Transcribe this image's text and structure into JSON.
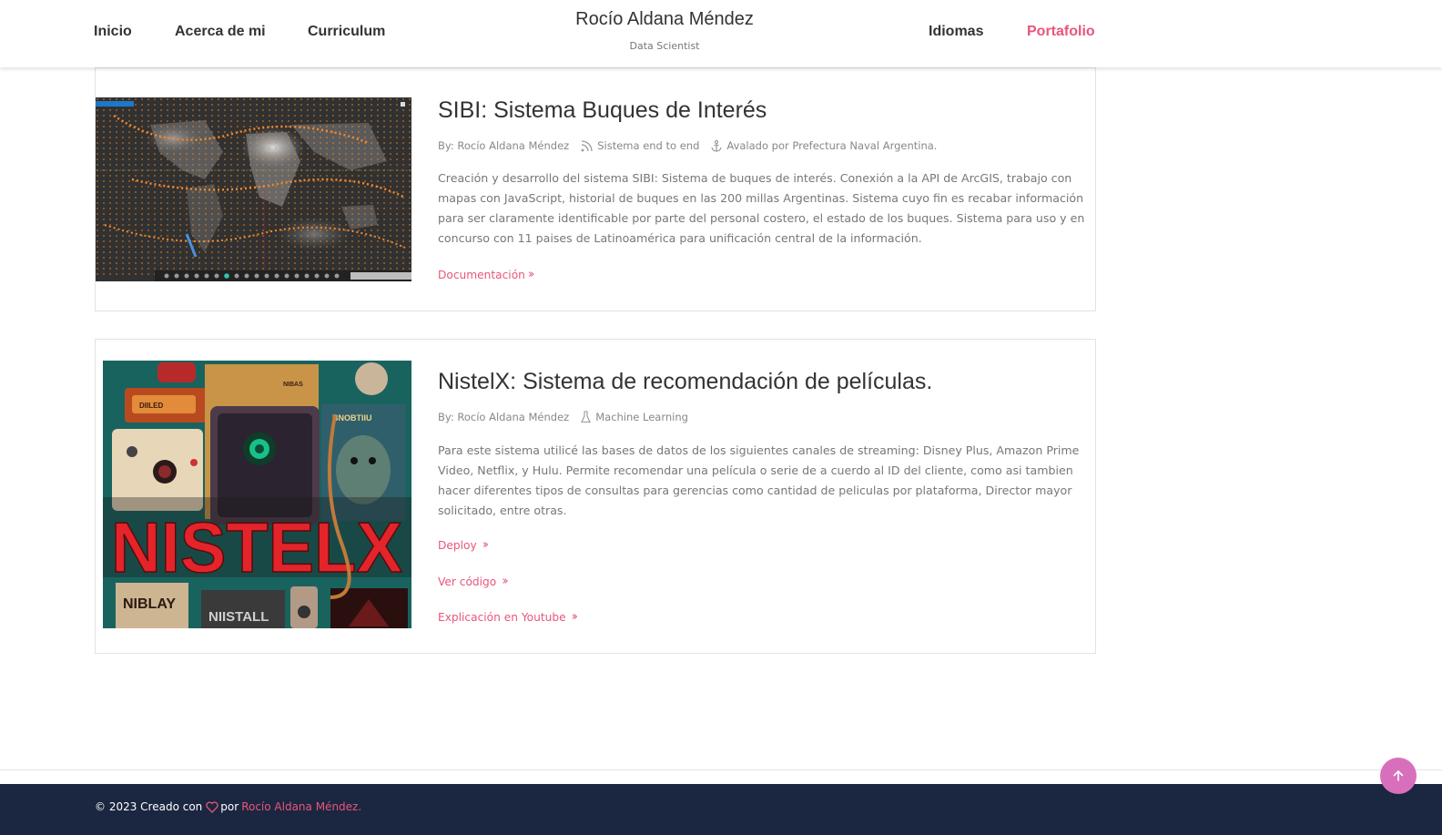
{
  "nav": {
    "left": [
      "Inicio",
      "Acerca de mi",
      "Curriculum"
    ],
    "right": [
      "Idiomas",
      "Portafolio"
    ]
  },
  "brand": {
    "name": "Rocío Aldana Méndez",
    "subtitle": "Data Scientist"
  },
  "projects": [
    {
      "title": "SIBI: Sistema Buques de Interés",
      "meta": [
        {
          "icon": "user",
          "text": "By: Rocío Aldana Méndez"
        },
        {
          "icon": "rss-icon",
          "text": "Sistema end to end"
        },
        {
          "icon": "anchor-icon",
          "text": "Avalado por Prefectura Naval Argentina."
        }
      ],
      "description": "Creación y desarrollo del sistema SIBI: Sistema de buques de interés. Conexión a la API de ArcGIS, trabajo con mapas con JavaScript, historial de buques en las 200 millas Argentinas. Sistema cuyo fin es recabar información para ser claramente identificable por parte del personal costero, el estado de los buques. Sistema para uso y en concurso con 11 paises de Latinoamérica para unificación central de la información.",
      "links": [
        "Documentación"
      ]
    },
    {
      "title": "NistelX: Sistema de recomendación de películas.",
      "meta": [
        {
          "icon": "user",
          "text": "By: Rocío Aldana Méndez"
        },
        {
          "icon": "flask-icon",
          "text": "Machine Learning"
        }
      ],
      "description": "Para este sistema utilicé las bases de datos de los siguientes canales de streaming: Disney Plus, Amazon Prime Video, Netflix, y Hulu. Permite recomendar una película o serie de a cuerdo al ID del cliente, como asi tambien hacer diferentes tipos de consultas para gerencias como cantidad de peliculas por plataforma, Director mayor solicitado, entre otras.",
      "links": [
        "Deploy",
        "Ver código",
        "Explicación en Youtube"
      ],
      "image_text": {
        "main": "NISTELX",
        "tag1": "NIBLAY",
        "tag2": "NIISTALL",
        "poster": "BNOBTIIU",
        "box1": "DIILED",
        "box2": "NIBAS"
      }
    }
  ],
  "footer": {
    "prefix": "© 2023 Creado con",
    "by": "por",
    "author": "Rocío Aldana Méndez."
  },
  "colors": {
    "accent": "#e8567a",
    "footer_bg": "#1b2640",
    "to_top": "#d86fbd"
  }
}
